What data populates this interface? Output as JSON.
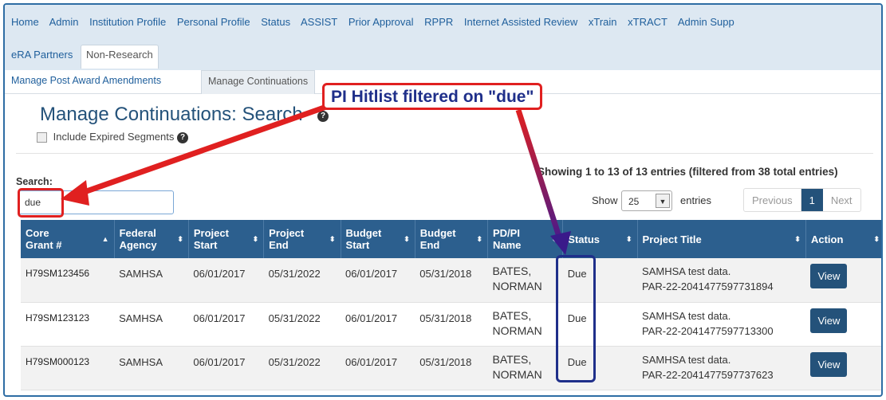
{
  "top_nav": {
    "items": [
      "Home",
      "Admin",
      "Institution Profile",
      "Personal Profile",
      "Status",
      "ASSIST",
      "Prior Approval",
      "RPPR",
      "Internet Assisted Review",
      "xTrain",
      "xTRACT",
      "Admin Supp"
    ],
    "row2": [
      "eRA Partners",
      "Non-Research"
    ]
  },
  "sub_nav": {
    "items": [
      "Manage Post Award Amendments",
      "Manage Continuations"
    ]
  },
  "page": {
    "title": "Manage Continuations: Search",
    "include_expired_label": "Include Expired Segments"
  },
  "search": {
    "label": "Search:",
    "value": "due"
  },
  "table_info": {
    "showing": "Showing 1 to 13 of 13 entries (filtered from 38 total entries)",
    "show_label": "Show",
    "page_size": "25",
    "entries_label": "entries",
    "prev": "Previous",
    "current_page": "1",
    "next": "Next"
  },
  "columns": [
    {
      "line1": "Core",
      "line2": "Grant #",
      "sort": "▲"
    },
    {
      "line1": "Federal",
      "line2": "Agency",
      "sort": "⬍"
    },
    {
      "line1": "Project",
      "line2": "Start",
      "sort": "⬍"
    },
    {
      "line1": "Project",
      "line2": "End",
      "sort": "⬍"
    },
    {
      "line1": "Budget",
      "line2": "Start",
      "sort": "⬍"
    },
    {
      "line1": "Budget",
      "line2": "End",
      "sort": "⬍"
    },
    {
      "line1": "PD/PI",
      "line2": "Name",
      "sort": "⬍"
    },
    {
      "line1": "Status",
      "line2": "",
      "sort": "⬍"
    },
    {
      "line1": "Project Title",
      "line2": "",
      "sort": "⬍"
    },
    {
      "line1": "Action",
      "line2": "",
      "sort": "⬍"
    }
  ],
  "rows": [
    {
      "grant": "H79SM123456",
      "agency": "SAMHSA",
      "pstart": "06/01/2017",
      "pend": "05/31/2022",
      "bstart": "06/01/2017",
      "bend": "05/31/2018",
      "pi1": "BATES,",
      "pi2": "NORMAN",
      "status": "Due",
      "title1": "SAMHSA test data.",
      "title2": "PAR-22-2041477597731894",
      "action": "View"
    },
    {
      "grant": "H79SM123123",
      "agency": "SAMHSA",
      "pstart": "06/01/2017",
      "pend": "05/31/2022",
      "bstart": "06/01/2017",
      "bend": "05/31/2018",
      "pi1": "BATES,",
      "pi2": "NORMAN",
      "status": "Due",
      "title1": "SAMHSA test data.",
      "title2": "PAR-22-2041477597713300",
      "action": "View"
    },
    {
      "grant": "H79SM000123",
      "agency": "SAMHSA",
      "pstart": "06/01/2017",
      "pend": "05/31/2022",
      "bstart": "06/01/2017",
      "bend": "05/31/2018",
      "pi1": "BATES,",
      "pi2": "NORMAN",
      "status": "Due",
      "title1": "SAMHSA test data.",
      "title2": "PAR-22-2041477597737623",
      "action": "View"
    }
  ],
  "annotation": {
    "text": "PI Hitlist filtered on \"due\""
  },
  "colors": {
    "header_bg": "#2c5f8e",
    "nav_bg": "#dde8f2",
    "callout_border": "#e02020",
    "status_box": "#1f2f8a"
  }
}
